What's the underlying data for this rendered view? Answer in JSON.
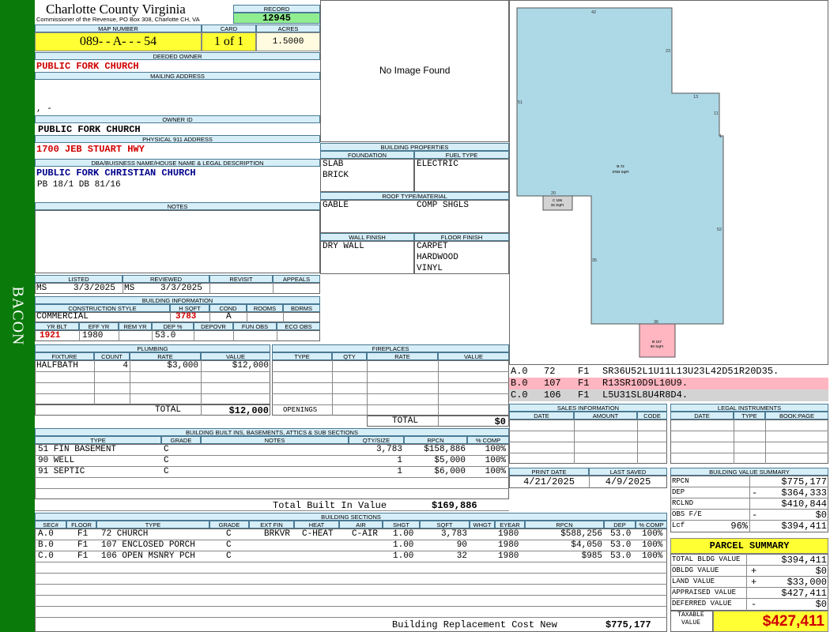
{
  "sidebar": {
    "district": "BACON"
  },
  "header": {
    "county": "Charlotte County Virginia",
    "commissioner": "Commissioner of the Revenue, PO Box 308, Charlotte CH, VA",
    "record_label": "RECORD",
    "record": "12945",
    "map_label": "MAP NUMBER",
    "map_number": "089- - A- - - 54",
    "card_label": "CARD",
    "card": "1 of 1",
    "acres_label": "ACRES",
    "acres": "1.5000"
  },
  "owner": {
    "deeded_label": "DEEDED OWNER",
    "deeded_owner": "PUBLIC FORK CHURCH",
    "mailing_label": "MAILING ADDRESS",
    "mailing_line": ", -",
    "owner_id_label": "OWNER ID",
    "owner_id": "PUBLIC FORK CHURCH",
    "physical_label": "PHYSICAL 911 ADDRESS",
    "physical_address": "1700 JEB STUART HWY",
    "dba_label": "DBA/BUISNESS NAME/HOUSE NAME & LEGAL DESCRIPTION",
    "dba_name": "PUBLIC FORK CHRISTIAN CHURCH",
    "legal": "PB 18/1 DB 81/16",
    "notes_label": "NOTES"
  },
  "photo": {
    "message": "No Image Found"
  },
  "listing": {
    "listed_label": "LISTED",
    "reviewed_label": "REVIEWED",
    "revisit_label": "REVISIT",
    "appeals_label": "APPEALS",
    "listed_by": "MS",
    "listed_date": "3/3/2025",
    "reviewed_by": "MS",
    "reviewed_date": "3/3/2025"
  },
  "building_info": {
    "title": "BUILDING INFORMATION",
    "labels": {
      "style": "CONSTRUCTION STYLE",
      "hsqft": "H SQFT",
      "cond": "COND",
      "rooms": "ROOMS",
      "bdrms": "BDRMS",
      "yrblt": "YR BLT",
      "effyr": "EFF YR",
      "remyr": "REM YR",
      "dep": "DEP %",
      "depovr": "DEPOVR",
      "funobs": "FUN OBS",
      "ecoobs": "ECO OBS"
    },
    "style": "COMMERCIAL",
    "hsqft": "3783",
    "cond": "A",
    "yrblt": "1921",
    "effyr": "1980",
    "dep": "53.0"
  },
  "building_props": {
    "title": "BUILDING PROPERTIES",
    "foundation_label": "FOUNDATION",
    "foundation": [
      "SLAB",
      "BRICK"
    ],
    "fuel_label": "FUEL TYPE",
    "fuel": [
      "ELECTRIC"
    ],
    "roof_label": "ROOF TYPE/MATERIAL",
    "roof_type": "GABLE",
    "roof_material": "COMP SHGLS",
    "wall_label": "WALL FINISH",
    "wall": [
      "DRY WALL"
    ],
    "floor_label": "FLOOR FINISH",
    "floor": [
      "CARPET",
      "HARDWOOD",
      "VINYL"
    ]
  },
  "plumbing": {
    "title": "PLUMBING",
    "cols": [
      "FIXTURE",
      "COUNT",
      "RATE",
      "VALUE"
    ],
    "rows": [
      {
        "fixture": "HALFBATH",
        "count": "4",
        "rate": "$3,000",
        "value": "$12,000"
      }
    ],
    "total_label": "TOTAL",
    "total": "$12,000"
  },
  "fireplaces": {
    "title": "FIREPLACES",
    "cols": [
      "TYPE",
      "QTY",
      "RATE",
      "VALUE"
    ],
    "openings_label": "OPENINGS",
    "total_label": "TOTAL",
    "total": "$0"
  },
  "builtins": {
    "title": "BUILDING BUILT INS, BASEMENTS, ATTICS & SUB SECTIONS",
    "cols": [
      "TYPE",
      "GRADE",
      "NOTES",
      "QTY/SIZE",
      "RPCN",
      "% COMP"
    ],
    "rows": [
      {
        "type": "51 FIN BASEMENT",
        "grade": "C",
        "qty": "3,783",
        "rpcn": "$158,886",
        "comp": "100%"
      },
      {
        "type": "90 WELL",
        "grade": "C",
        "qty": "1",
        "rpcn": "$5,000",
        "comp": "100%"
      },
      {
        "type": "91 SEPTIC",
        "grade": "C",
        "qty": "1",
        "rpcn": "$6,000",
        "comp": "100%"
      }
    ],
    "total_label": "Total Built In Value",
    "total": "$169,886"
  },
  "sections": {
    "title": "BUILDING SECTIONS",
    "cols": [
      "SEC#",
      "FLOOR",
      "TYPE",
      "GRADE",
      "EXT FIN",
      "HEAT",
      "AIR",
      "SHGT",
      "SQFT",
      "WHGT",
      "EYEAR",
      "RPCN",
      "DEP",
      "% COMP"
    ],
    "rows": [
      {
        "sec": "A.0",
        "floor": "F1",
        "type": "72 CHURCH",
        "grade": "C",
        "ext": "BRKVR",
        "heat": "C-HEAT",
        "air": "C-AIR",
        "shgt": "1.00",
        "sqft": "3,783",
        "eyear": "1980",
        "rpcn": "$588,256",
        "dep": "53.0",
        "comp": "100%"
      },
      {
        "sec": "B.0",
        "floor": "F1",
        "type": "107 ENCLOSED PORCH",
        "grade": "C",
        "ext": "",
        "heat": "",
        "air": "",
        "shgt": "1.00",
        "sqft": "90",
        "eyear": "1980",
        "rpcn": "$4,050",
        "dep": "53.0",
        "comp": "100%"
      },
      {
        "sec": "C.0",
        "floor": "F1",
        "type": "106 OPEN MSNRY PCH",
        "grade": "C",
        "ext": "",
        "heat": "",
        "air": "",
        "shgt": "1.00",
        "sqft": "32",
        "eyear": "1980",
        "rpcn": "$985",
        "dep": "53.0",
        "comp": "100%"
      }
    ],
    "total_label": "Building Replacement Cost New",
    "total": "$775,177"
  },
  "sketch": {
    "dims": [
      "42",
      "23",
      "13",
      "11",
      "1",
      "51",
      "20",
      "52",
      "35",
      "36"
    ],
    "main_label": "B 72",
    "main_area": "3783 SqFt",
    "c_label": "C 106",
    "c_area": "32 SqFt",
    "b_label": "B 107",
    "b_area": "90 SqFt",
    "colors": {
      "main": "#add8e6",
      "porch": "#ffb6c1",
      "stoop": "#d3d3d3"
    },
    "codes": [
      {
        "sec": "A.0",
        "type": "72",
        "floor": "F1",
        "code": "SR36U52L1U11L13U23L42D51R20D35."
      },
      {
        "sec": "B.0",
        "type": "107",
        "floor": "F1",
        "code": "R13SR10D9L10U9."
      },
      {
        "sec": "C.0",
        "type": "106",
        "floor": "F1",
        "code": "L5U31SL8U4R8D4."
      }
    ]
  },
  "sales": {
    "title": "SALES INFORMATION",
    "cols": [
      "DATE",
      "AMOUNT",
      "CODE"
    ]
  },
  "legal": {
    "title": "LEGAL INSTRUMENTS",
    "cols": [
      "DATE",
      "TYPE",
      "BOOK:PAGE"
    ]
  },
  "dates": {
    "print_label": "PRINT DATE",
    "print_date": "4/21/2025",
    "saved_label": "LAST SAVED",
    "saved_date": "4/9/2025"
  },
  "value_summary": {
    "title": "BUILDING VALUE SUMMARY",
    "rpcn_label": "RPCN",
    "rpcn": "$775,177",
    "dep_label": "DEP",
    "dep_sign": "-",
    "dep": "$364,333",
    "rclnd_label": "RCLND",
    "rclnd": "$410,844",
    "obs_label": "OBS F/E",
    "obs_sign": "-",
    "obs": "$0",
    "lcf_label": "Lcf",
    "lcf_pct": "96%",
    "lcf": "$394,411"
  },
  "parcel": {
    "title": "PARCEL SUMMARY",
    "bldg_label": "TOTAL BLDG VALUE",
    "bldg": "$394,411",
    "obldg_label": "OBLDG VALUE",
    "obldg_sign": "+",
    "obldg": "$0",
    "land_label": "LAND VALUE",
    "land_sign": "+",
    "land": "$33,000",
    "appraised_label": "APPRAISED VALUE",
    "appraised": "$427,411",
    "deferred_label": "DEFERRED VALUE",
    "deferred_sign": "-",
    "deferred": "$0",
    "taxable_label": "TAXABLE VALUE",
    "taxable": "$427,411"
  }
}
